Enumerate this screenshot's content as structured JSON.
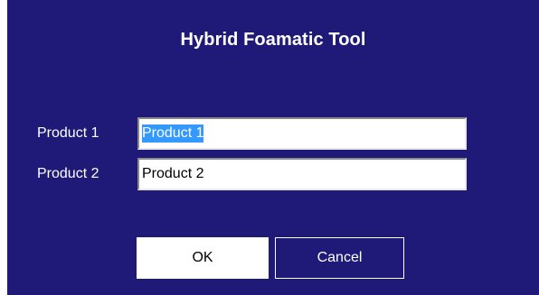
{
  "dialog": {
    "title": "Hybrid Foamatic Tool",
    "background_color": "#1f1a78"
  },
  "fields": [
    {
      "label": "Product 1",
      "value": "Product 1",
      "selected": true
    },
    {
      "label": "Product 2",
      "value": "Product 2",
      "selected": false
    }
  ],
  "buttons": {
    "ok_label": "OK",
    "cancel_label": "Cancel"
  },
  "colors": {
    "selection": "#3399ff",
    "text_on_dark": "#ffffff"
  }
}
